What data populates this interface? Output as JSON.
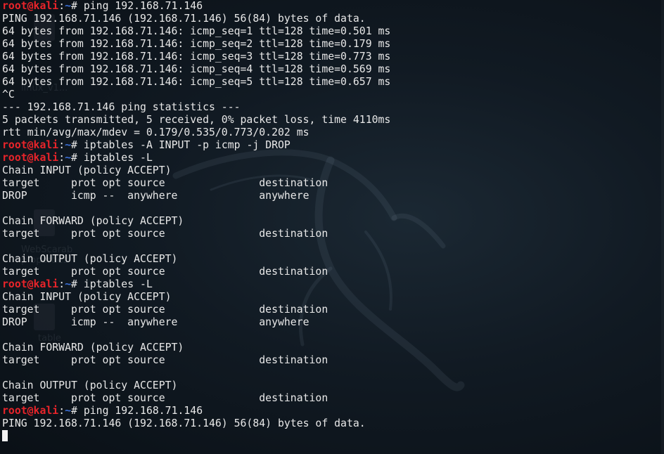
{
  "terminal": {
    "prompt": {
      "user": "root@kali",
      "separator": ":",
      "path": "~",
      "symbol": "# "
    },
    "lines": [
      {
        "type": "prompt",
        "command": "ping 192.168.71.146"
      },
      {
        "type": "output",
        "text": "PING 192.168.71.146 (192.168.71.146) 56(84) bytes of data."
      },
      {
        "type": "output",
        "text": "64 bytes from 192.168.71.146: icmp_seq=1 ttl=128 time=0.501 ms"
      },
      {
        "type": "output",
        "text": "64 bytes from 192.168.71.146: icmp_seq=2 ttl=128 time=0.179 ms"
      },
      {
        "type": "output",
        "text": "64 bytes from 192.168.71.146: icmp_seq=3 ttl=128 time=0.773 ms"
      },
      {
        "type": "output",
        "text": "64 bytes from 192.168.71.146: icmp_seq=4 ttl=128 time=0.569 ms"
      },
      {
        "type": "output",
        "text": "64 bytes from 192.168.71.146: icmp_seq=5 ttl=128 time=0.657 ms"
      },
      {
        "type": "output",
        "text": "^C"
      },
      {
        "type": "output",
        "text": "--- 192.168.71.146 ping statistics ---"
      },
      {
        "type": "output",
        "text": "5 packets transmitted, 5 received, 0% packet loss, time 4110ms"
      },
      {
        "type": "output",
        "text": "rtt min/avg/max/mdev = 0.179/0.535/0.773/0.202 ms"
      },
      {
        "type": "prompt",
        "command": "iptables -A INPUT -p icmp -j DROP"
      },
      {
        "type": "prompt",
        "command": "iptables -L"
      },
      {
        "type": "output",
        "text": "Chain INPUT (policy ACCEPT)"
      },
      {
        "type": "output",
        "text": "target     prot opt source               destination"
      },
      {
        "type": "output",
        "text": "DROP       icmp --  anywhere             anywhere"
      },
      {
        "type": "output",
        "text": ""
      },
      {
        "type": "output",
        "text": "Chain FORWARD (policy ACCEPT)"
      },
      {
        "type": "output",
        "text": "target     prot opt source               destination"
      },
      {
        "type": "output",
        "text": ""
      },
      {
        "type": "output",
        "text": "Chain OUTPUT (policy ACCEPT)"
      },
      {
        "type": "output",
        "text": "target     prot opt source               destination"
      },
      {
        "type": "prompt",
        "command": "iptables -L"
      },
      {
        "type": "output",
        "text": "Chain INPUT (policy ACCEPT)"
      },
      {
        "type": "output",
        "text": "target     prot opt source               destination"
      },
      {
        "type": "output",
        "text": "DROP       icmp --  anywhere             anywhere"
      },
      {
        "type": "output",
        "text": ""
      },
      {
        "type": "output",
        "text": "Chain FORWARD (policy ACCEPT)"
      },
      {
        "type": "output",
        "text": "target     prot opt source               destination"
      },
      {
        "type": "output",
        "text": ""
      },
      {
        "type": "output",
        "text": "Chain OUTPUT (policy ACCEPT)"
      },
      {
        "type": "output",
        "text": "target     prot opt source               destination"
      },
      {
        "type": "prompt",
        "command": "ping 192.168.71.146"
      },
      {
        "type": "output",
        "text": "PING 192.168.71.146 (192.168.71.146) 56(84) bytes of data."
      },
      {
        "type": "cursor"
      }
    ]
  },
  "colors": {
    "background": "#111a23",
    "text": "#e8e8e8",
    "prompt_user": "#e8242a",
    "prompt_path": "#3b6fd6",
    "cursor": "#f2f2f2"
  },
  "background_icons": {
    "dragon": "kali-dragon-logo",
    "desktop_labels": [
      "linux_v1...",
      "WebScarab properties",
      "table"
    ]
  }
}
